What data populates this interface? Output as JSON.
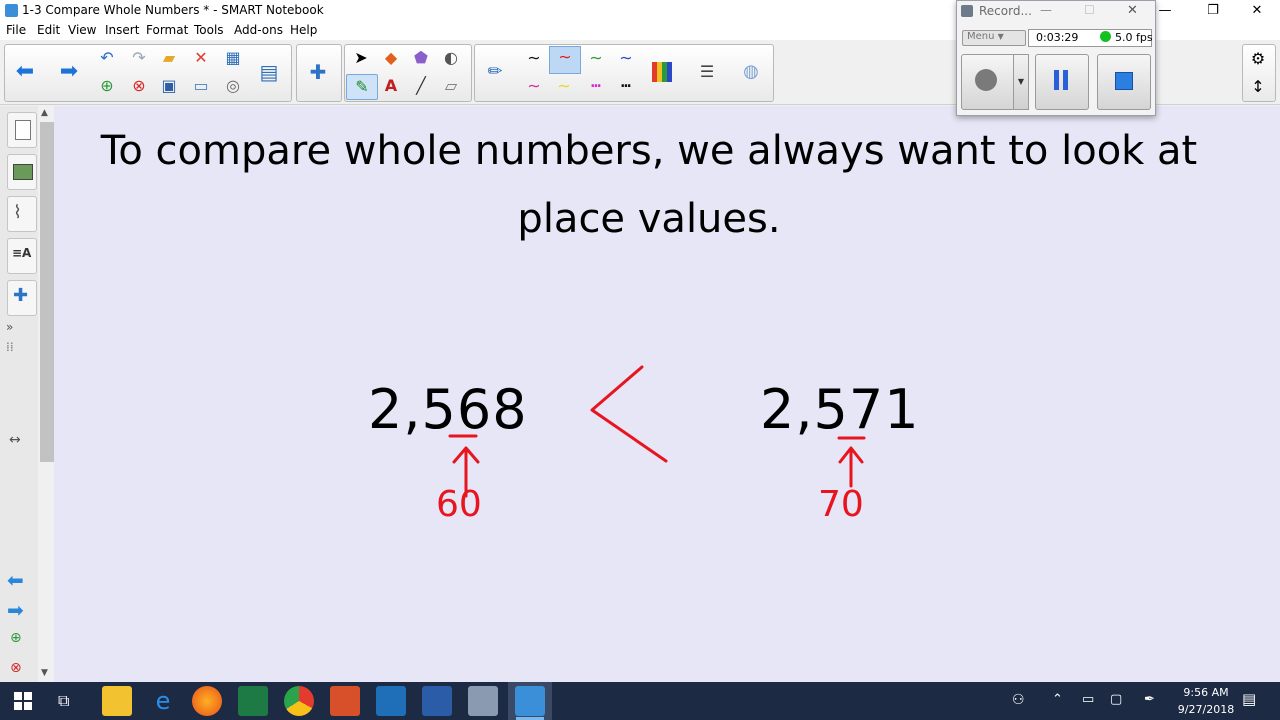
{
  "window": {
    "title": "1-3 Compare Whole Numbers * - SMART Notebook",
    "minimize": "—",
    "restore": "❐",
    "close": "✕"
  },
  "menu": [
    "File",
    "Edit",
    "View",
    "Insert",
    "Format",
    "Tools",
    "Add-ons",
    "Help"
  ],
  "recorder": {
    "title": "Record...",
    "menu_label": "Menu",
    "elapsed": "0:03:29",
    "fps": "5.0 fps"
  },
  "page": {
    "heading_line1": "To compare whole numbers, we always want to look at",
    "heading_line2": "place values.",
    "number_left": "2,568",
    "number_right": "2,571",
    "annotation_left": "60",
    "annotation_right": "70"
  },
  "taskbar": {
    "time": "9:56 AM",
    "date": "9/27/2018"
  },
  "colors": {
    "canvas": "#e6e6f7",
    "ink_red": "#e8141e",
    "taskbar": "#1c2a44"
  }
}
